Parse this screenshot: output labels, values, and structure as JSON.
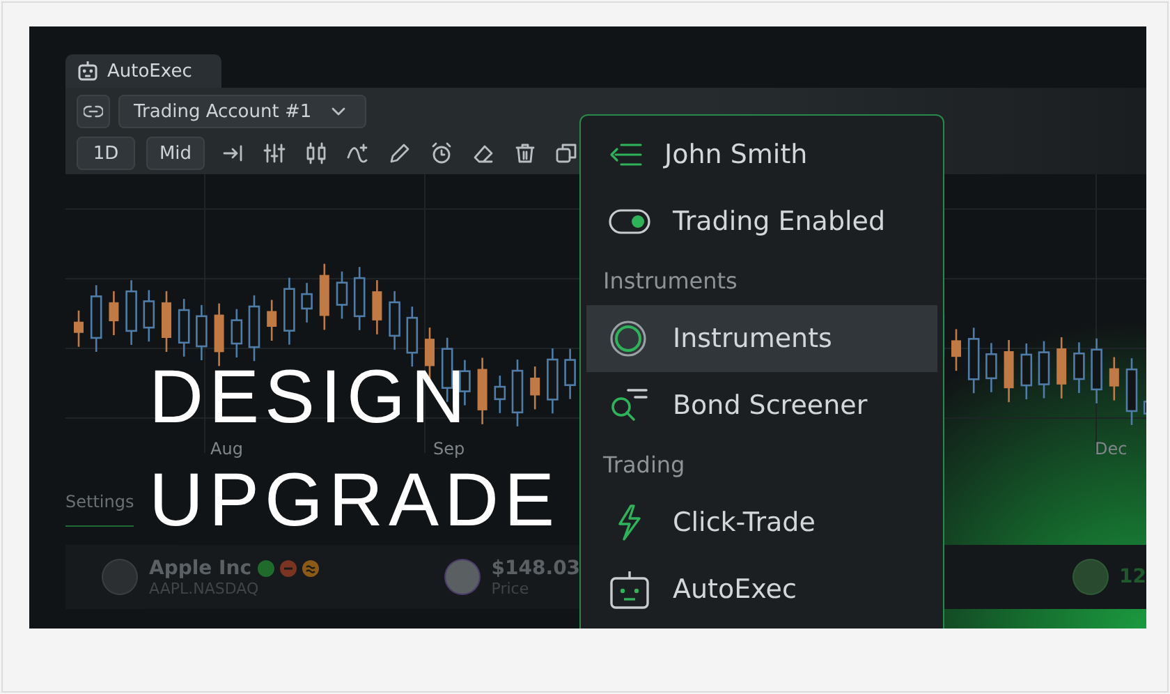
{
  "window": {
    "tab": {
      "label": "AutoExec"
    }
  },
  "toolbar": {
    "account": "Trading Account #1",
    "interval": "1D",
    "price_type": "Mid"
  },
  "chart": {
    "x_labels": [
      "Aug",
      "Sep",
      "Dec"
    ]
  },
  "panel": {
    "tabs": [
      {
        "label": "Settings"
      }
    ]
  },
  "asset": {
    "name": "Apple Inc",
    "symbol": "AAPL.NASDAQ",
    "status_icons": [
      {
        "kind": "dot",
        "color": "#1e6b2c"
      },
      {
        "kind": "minus",
        "color": "#7a3422"
      },
      {
        "kind": "approx",
        "color": "#8a5a16"
      }
    ],
    "price": "$148.03",
    "price_label": "Price",
    "column_3": "12"
  },
  "headline": [
    "DESIGN",
    "UPGRADE"
  ],
  "menu": {
    "user": "John Smith",
    "trading": {
      "label": "Trading Enabled",
      "on": true
    },
    "sections": [
      {
        "title": "Instruments",
        "items": [
          {
            "label": "Instruments",
            "kind": "instruments",
            "selected": true
          },
          {
            "label": "Bond Screener",
            "kind": "screener",
            "selected": false
          }
        ]
      },
      {
        "title": "Trading",
        "items": [
          {
            "label": "Click-Trade",
            "kind": "trade",
            "selected": false
          },
          {
            "label": "AutoExec",
            "kind": "robot",
            "selected": false
          }
        ]
      }
    ]
  }
}
